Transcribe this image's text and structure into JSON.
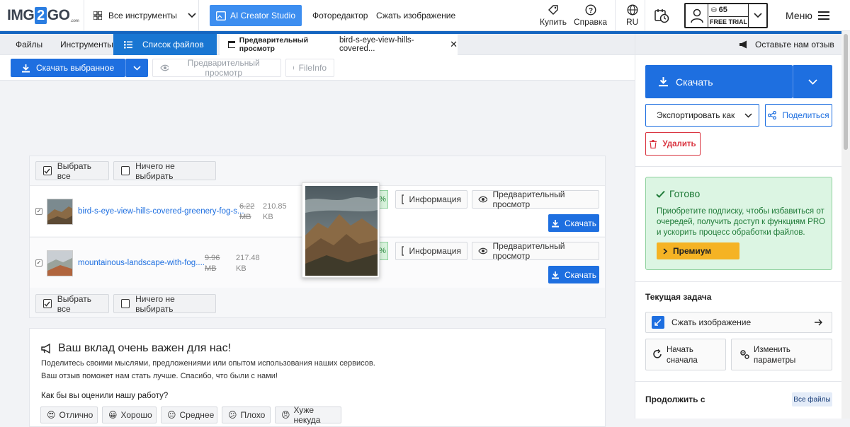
{
  "header": {
    "logo_left": "IMG",
    "logo_mid": "2",
    "logo_right": "GO",
    "logo_suffix": ".com",
    "all_tools": "Все инструменты",
    "ai_creator": "AI Creator Studio",
    "photo_editor": "Фоторедактор",
    "compress": "Сжать изображение",
    "buy": "Купить",
    "help": "Справка",
    "lang": "RU",
    "credits": "65",
    "free_trial": "FREE TRIAL",
    "menu": "Меню"
  },
  "tabs": {
    "files": "Файлы",
    "tools": "Инструменты",
    "file_list": "Список файлов",
    "preview_label": "Предварительный просмотр",
    "preview_file": "bird-s-eye-view-hills-covered...",
    "feedback": "Оставьте нам отзыв"
  },
  "toolbar": {
    "download_selected": "Скачать выбранное",
    "preview": "Предварительный просмотр",
    "fileinfo": "FileInfo"
  },
  "selection": {
    "select_all": "Выбрать все",
    "select_none": "Ничего не выбирать"
  },
  "files": [
    {
      "name": "bird-s-eye-view-hills-covered-greenery-fog-s...",
      "old_size": "6.22",
      "old_unit": "MB",
      "new_size": "210.85",
      "new_unit": "KB",
      "percent": "%"
    },
    {
      "name": "mountainous-landscape-with-fog....",
      "old_size": "9.96",
      "old_unit": "MB",
      "new_size": "217.48",
      "new_unit": "KB",
      "percent": "%"
    }
  ],
  "file_actions": {
    "info": "Информация",
    "preview": "Предварительный просмотр",
    "download": "Скачать"
  },
  "feedback": {
    "title": "Ваш вклад очень важен для нас!",
    "line1": "Поделитесь своими мыслями, предложениями или опытом использования наших сервисов.",
    "line2": "Ваш отзыв поможет нам стать лучше. Спасибо, что были с нами!",
    "question": "Как бы вы оценили нашу работу?",
    "ratings": [
      "Отлично",
      "Хорошо",
      "Среднее",
      "Плохо",
      "Хуже некуда"
    ],
    "rating_emojis": [
      "😍",
      "😀",
      "😐",
      "😕",
      "😠"
    ]
  },
  "sidebar": {
    "download": "Скачать",
    "export_as": "Экспортировать как",
    "share": "Поделиться",
    "delete": "Удалить",
    "ready_title": "Готово",
    "ready_text": "Приобретите подписку, чтобы избавиться от очередей, получить доступ к функциям PRO и ускорить процесс обработки файлов.",
    "premium": "Премиум",
    "current_task": "Текущая задача",
    "task_name": "Сжать изображение",
    "restart": "Начать сначала",
    "change_params": "Изменить параметры",
    "continue_with": "Продолжить с",
    "all_files": "Все файлы"
  },
  "colors": {
    "primary": "#1e6fe0",
    "accent_blue": "#3d8ef0",
    "success_bg": "#dcf5e3",
    "premium": "#f5b324",
    "danger": "#d9333f"
  }
}
